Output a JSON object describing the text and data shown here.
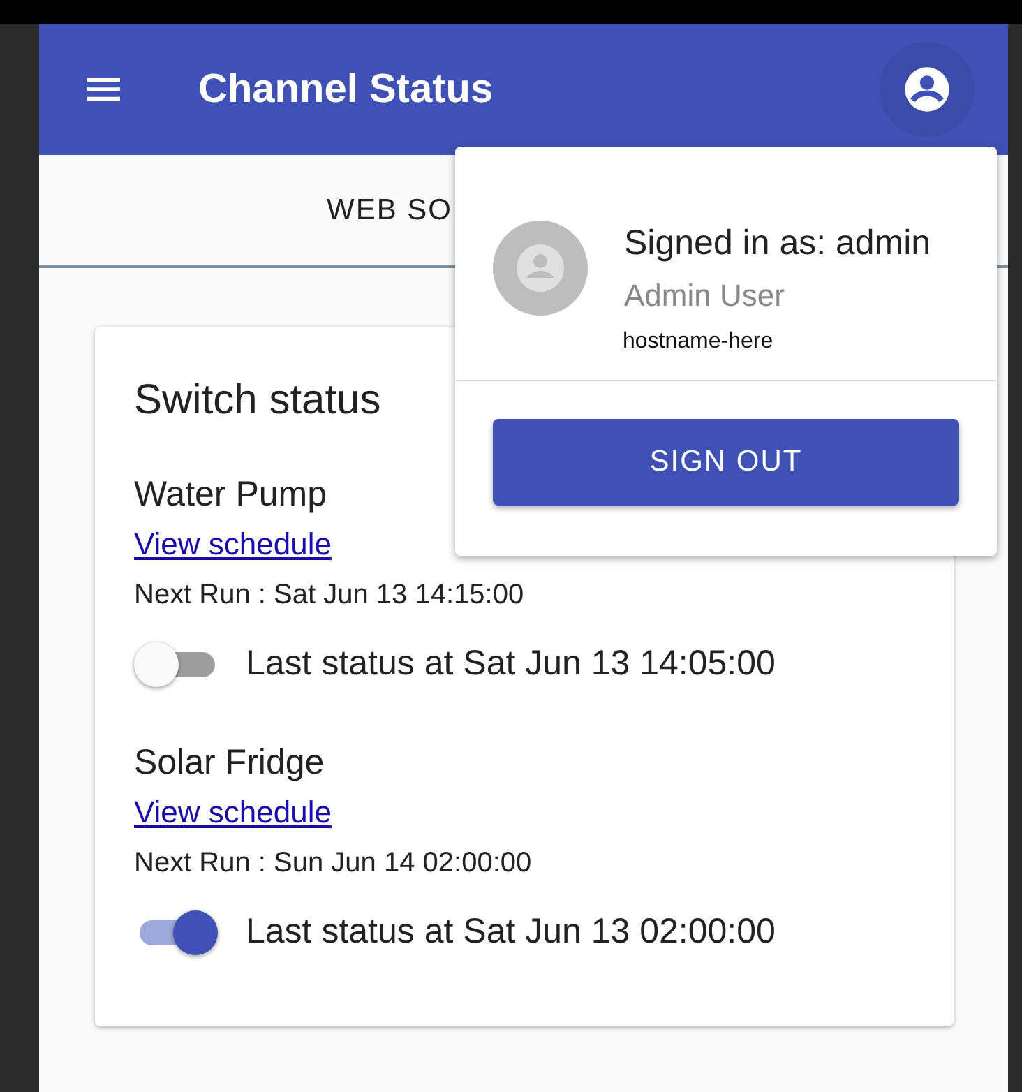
{
  "app_bar": {
    "title": "Channel Status"
  },
  "tabs": [
    {
      "label": "WEB SO",
      "selected": true
    }
  ],
  "card": {
    "title": "Switch status",
    "switches": [
      {
        "name": "Water Pump",
        "link": "View schedule",
        "next_run": "Next Run : Sat Jun 13 14:15:00",
        "on": false,
        "last_status": "Last status at Sat Jun 13 14:05:00"
      },
      {
        "name": "Solar Fridge",
        "link": "View schedule",
        "next_run": "Next Run : Sun Jun 14 02:00:00",
        "on": true,
        "last_status": "Last status at Sat Jun 13 02:00:00"
      }
    ]
  },
  "account_menu": {
    "signed_in": "Signed in as: admin",
    "full_name": "Admin User",
    "host": "hostname-here",
    "button": "SIGN OUT"
  }
}
